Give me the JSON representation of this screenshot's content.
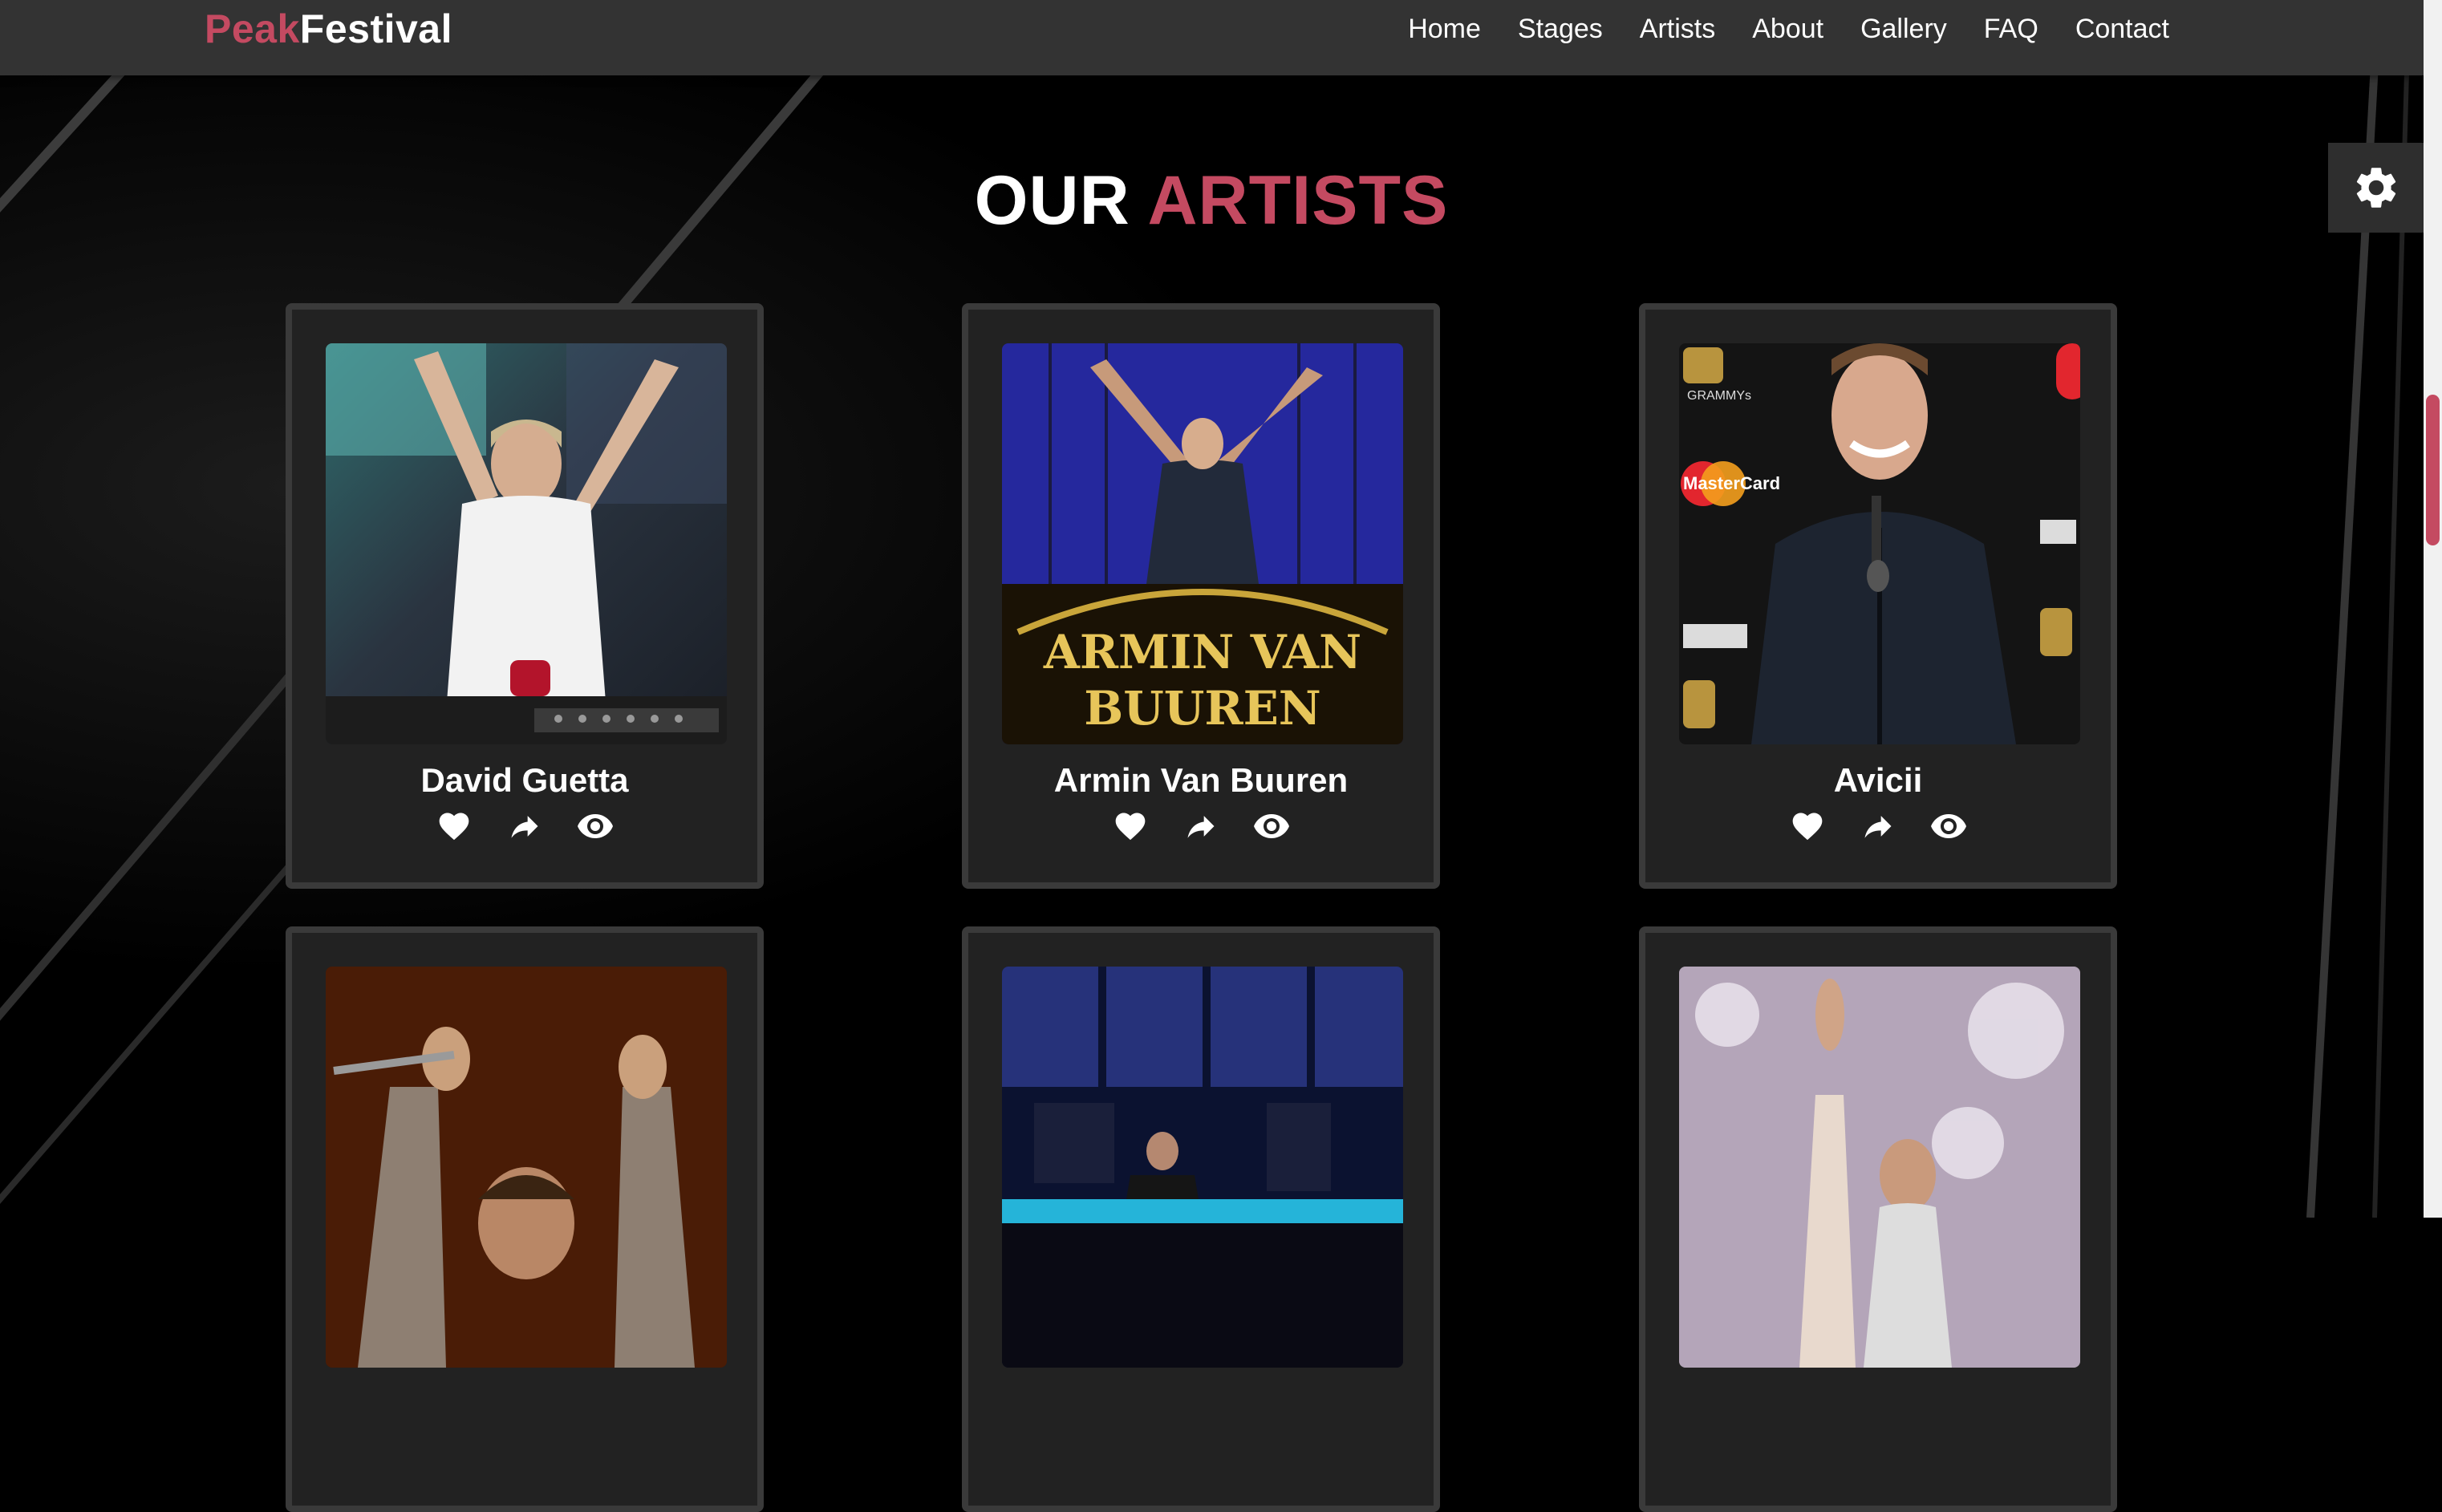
{
  "brand": {
    "part1": "Peak",
    "part2": "Festival"
  },
  "nav": {
    "items": [
      {
        "label": "Home"
      },
      {
        "label": "Stages"
      },
      {
        "label": "Artists"
      },
      {
        "label": "About"
      },
      {
        "label": "Gallery"
      },
      {
        "label": "FAQ"
      },
      {
        "label": "Contact"
      }
    ]
  },
  "section": {
    "title_white": "OUR",
    "title_accent": "ARTISTS"
  },
  "artists": [
    {
      "name": "David Guetta",
      "photo_icon": "dj-performer-photo"
    },
    {
      "name": "Armin Van Buuren",
      "photo_icon": "stage-performer-photo",
      "photo_text_line1": "ARMIN VAN",
      "photo_text_line2": "BUUREN"
    },
    {
      "name": "Avicii",
      "photo_icon": "press-wall-portrait-photo",
      "photo_text_line1": "GRAMMYs",
      "photo_text_line2": "MasterCard"
    },
    {
      "name": "",
      "photo_icon": "hands-up-performer-photo"
    },
    {
      "name": "",
      "photo_icon": "dj-booth-photo"
    },
    {
      "name": "",
      "photo_icon": "raised-hand-performer-photo"
    }
  ],
  "actions": [
    {
      "icon": "heart-icon"
    },
    {
      "icon": "share-icon"
    },
    {
      "icon": "eye-icon"
    }
  ],
  "colors": {
    "accent": "#c44a61",
    "navbar": "#333333",
    "card": "#222222",
    "card_border": "#3a3a3a",
    "background": "#000000"
  }
}
